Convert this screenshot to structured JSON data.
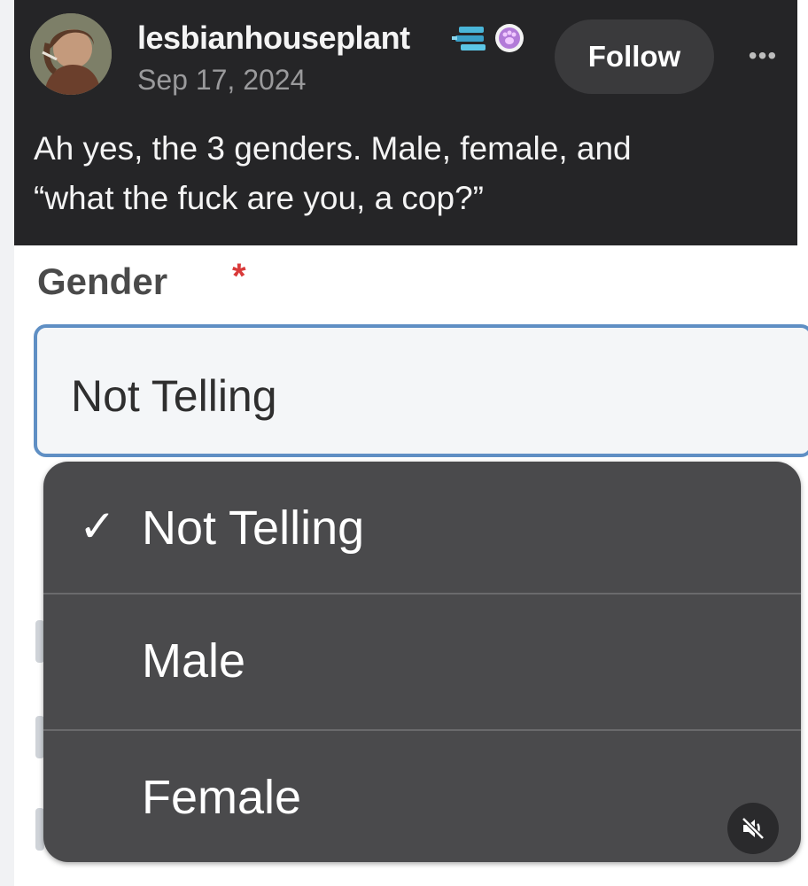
{
  "post": {
    "username": "lesbianhouseplant",
    "date": "Sep 17, 2024",
    "follow_label": "Follow",
    "more_label": "•••",
    "text_line1": "Ah yes, the 3 genders. Male, female, and",
    "text_line2": "“what the fuck are you, a cop?”",
    "badges": [
      "stack-badge-icon",
      "paw-badge-icon"
    ]
  },
  "form": {
    "gender_label": "Gender",
    "required_mark": "*",
    "selected_value": "Not Telling"
  },
  "dropdown": {
    "options": [
      {
        "label": "Not Telling",
        "selected": true,
        "check": "✓"
      },
      {
        "label": "Male",
        "selected": false
      },
      {
        "label": "Female",
        "selected": false
      }
    ]
  },
  "colors": {
    "post_bg": "#252527",
    "menu_bg": "#4a4a4c",
    "select_border": "#5f8fc4",
    "required": "#d93a3a"
  },
  "icons": {
    "mute": "speaker-muted-icon",
    "avatar": "avatar"
  }
}
